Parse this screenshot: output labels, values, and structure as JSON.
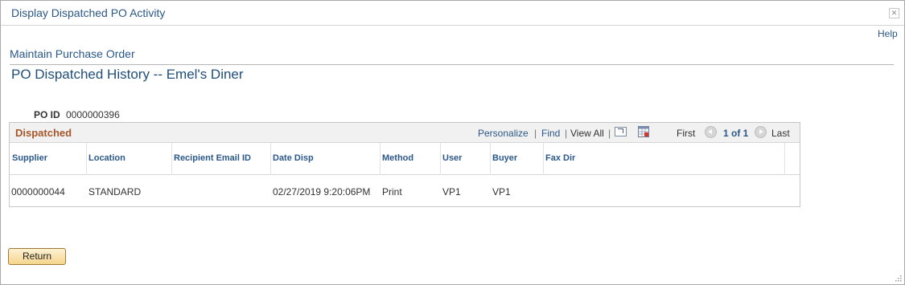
{
  "window": {
    "title": "Display Dispatched PO Activity"
  },
  "help": "Help",
  "breadcrumb": "Maintain Purchase Order",
  "page_title": "PO Dispatched History -- Emel's Diner",
  "po": {
    "label": "PO ID",
    "value": "0000000396"
  },
  "grid": {
    "title": "Dispatched",
    "nav": {
      "personalize": "Personalize",
      "sep1": "|",
      "find": "Find",
      "sep2": "|",
      "view_all": "View All",
      "sep3": "|",
      "first": "First",
      "range": "1 of 1",
      "last": "Last"
    },
    "columns": [
      "Supplier",
      "Location",
      "Recipient Email ID",
      "Date Disp",
      "Method",
      "User",
      "Buyer",
      "Fax Dir"
    ],
    "rows": [
      [
        "0000000044",
        "STANDARD",
        "",
        "02/27/2019  9:20:06PM",
        "Print",
        "VP1",
        "VP1",
        ""
      ]
    ]
  },
  "buttons": {
    "return": "Return"
  },
  "icons": [
    "close-icon",
    "zoom-icon",
    "download-icon",
    "prev-icon",
    "next-icon",
    "resize-grip-icon"
  ]
}
